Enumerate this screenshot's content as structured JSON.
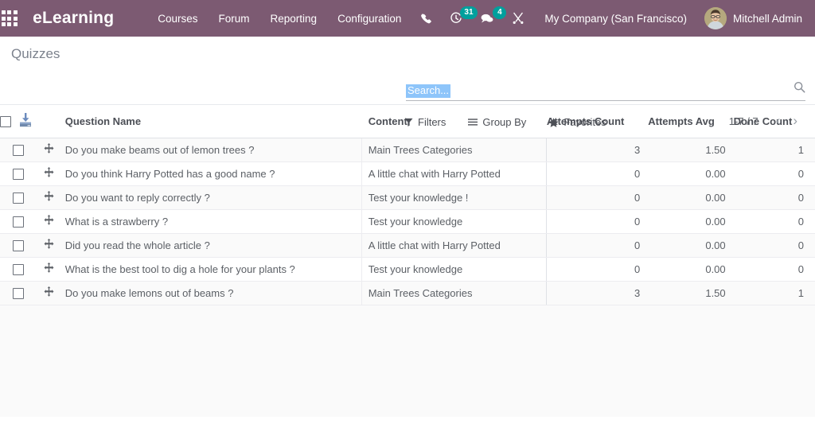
{
  "navbar": {
    "apps_icon": "grid-apps-icon",
    "brand": "eLearning",
    "menu": [
      {
        "label": "Courses"
      },
      {
        "label": "Forum"
      },
      {
        "label": "Reporting"
      },
      {
        "label": "Configuration"
      }
    ],
    "icons": [
      {
        "name": "phone-icon",
        "badge": null
      },
      {
        "name": "activity-clock-icon",
        "badge": "31"
      },
      {
        "name": "messages-icon",
        "badge": "4"
      },
      {
        "name": "developer-tools-icon",
        "badge": null
      }
    ],
    "company": "My Company (San Francisco)",
    "user": "Mitchell Admin",
    "accent_purple": "#7C5A72",
    "badge_color": "#00A09D"
  },
  "control_panel": {
    "title": "Quizzes",
    "import_icon": "import-download-icon",
    "search": {
      "value": "Search...",
      "placeholder": "Search...",
      "selected": true,
      "icon": "search-icon"
    },
    "buttons": [
      {
        "label": "Filters",
        "icon": "filter-icon"
      },
      {
        "label": "Group By",
        "icon": "bars-icon"
      },
      {
        "label": "Favorites",
        "icon": "star-icon"
      }
    ],
    "pager": {
      "value": "1-7 / 7",
      "prev": "‹",
      "next": "›"
    }
  },
  "table": {
    "columns": [
      "Question Name",
      "Content",
      "Attempts Count",
      "Attempts Avg",
      "Done Count"
    ],
    "rows": [
      {
        "name": "Do you make beams out of lemon trees ?",
        "content": "Main Trees Categories",
        "attempts_count": "3",
        "attempts_avg": "1.50",
        "done_count": "1"
      },
      {
        "name": "Do you think Harry Potted has a good name ?",
        "content": "A little chat with Harry Potted",
        "attempts_count": "0",
        "attempts_avg": "0.00",
        "done_count": "0"
      },
      {
        "name": "Do you want to reply correctly ?",
        "content": "Test your knowledge !",
        "attempts_count": "0",
        "attempts_avg": "0.00",
        "done_count": "0"
      },
      {
        "name": "What is a strawberry ?",
        "content": "Test your knowledge",
        "attempts_count": "0",
        "attempts_avg": "0.00",
        "done_count": "0"
      },
      {
        "name": "Did you read the whole article ?",
        "content": "A little chat with Harry Potted",
        "attempts_count": "0",
        "attempts_avg": "0.00",
        "done_count": "0"
      },
      {
        "name": "What is the best tool to dig a hole for your plants ?",
        "content": "Test your knowledge",
        "attempts_count": "0",
        "attempts_avg": "0.00",
        "done_count": "0"
      },
      {
        "name": "Do you make lemons out of beams ?",
        "content": "Main Trees Categories",
        "attempts_count": "3",
        "attempts_avg": "1.50",
        "done_count": "1"
      }
    ]
  }
}
